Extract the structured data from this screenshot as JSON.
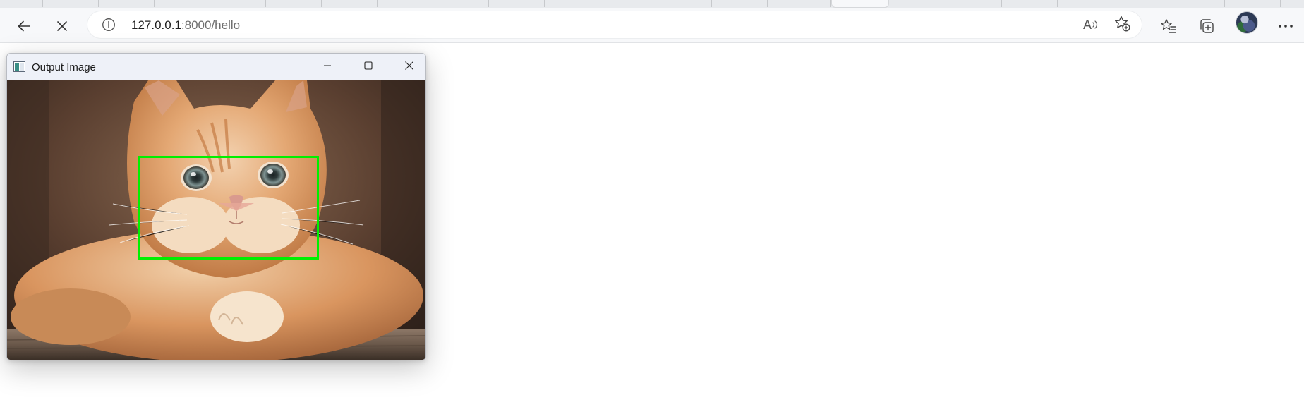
{
  "browser": {
    "address_bar": {
      "url_host": "127.0.0.1",
      "url_rest": ":8000/hello"
    },
    "icons": {
      "back": "arrow-left-icon",
      "stop": "close-icon",
      "site_info": "info-icon",
      "read_aloud": "read-aloud-icon",
      "add_favorite": "star-plus-icon",
      "favorites": "favorites-list-icon",
      "collections": "collections-icon",
      "profile": "avatar",
      "menu": "more-dots-icon"
    },
    "read_aloud_glyph": "A"
  },
  "output_window": {
    "title": "Output Image",
    "image_subject": "orange tabby kitten lying on a wooden surface",
    "detection_box_color": "#00f000",
    "controls": {
      "minimize": "minimize-icon",
      "maximize": "maximize-icon",
      "close": "close-icon"
    }
  },
  "colors": {
    "toolbar_bg": "#f7f8fa",
    "tabstrip_bg": "#e8eaed",
    "window_titlebar_bg": "#eef1f8"
  }
}
